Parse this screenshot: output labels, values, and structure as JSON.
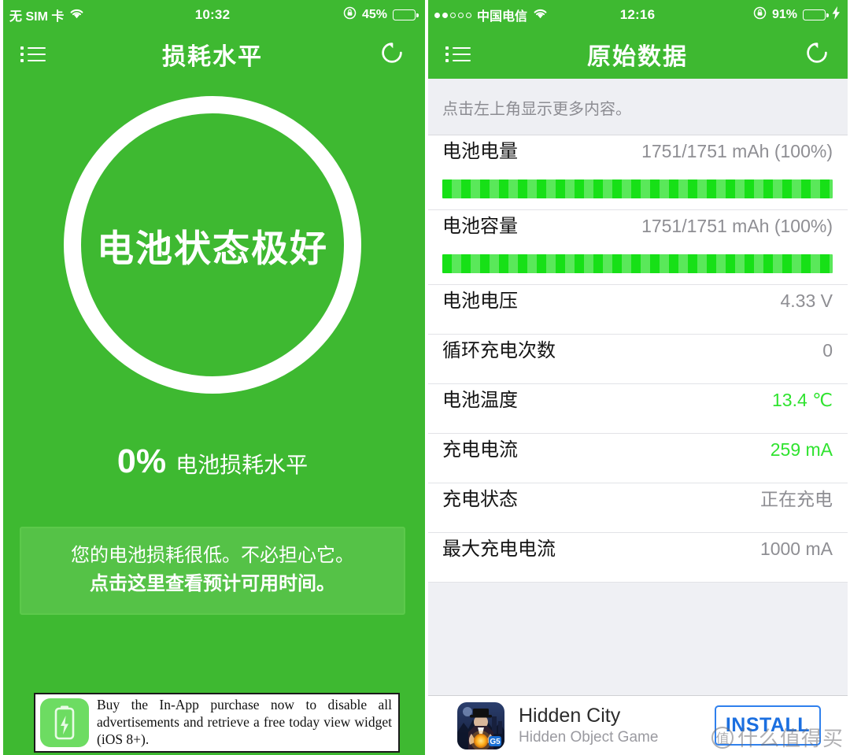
{
  "left": {
    "statusbar": {
      "carrier": "无 SIM 卡",
      "time": "10:32",
      "battery_pct": "45%",
      "battery_level": 45,
      "charging": false,
      "wifi": true,
      "lock_icon": "rotation-lock-icon"
    },
    "navbar": {
      "menu_icon": "list-menu-icon",
      "title": "损耗水平",
      "refresh_icon": "refresh-icon"
    },
    "gauge": {
      "status_text": "电池状态极好",
      "ring_color": "#ffffff",
      "background_color": "#3eb931"
    },
    "loss": {
      "percent": "0%",
      "label": "电池损耗水平"
    },
    "info_box": {
      "line1": "您的电池损耗很低。不必担心它。",
      "line2": "点击这里查看预计可用时间。",
      "background_color": "#55c247"
    },
    "ad": {
      "icon": "battery-bolt-icon",
      "text": "Buy the In-App purchase now to disable all advertisements and retrieve a free today view widget (iOS 8+)."
    }
  },
  "right": {
    "statusbar": {
      "signal_dots_filled": 2,
      "signal_dots_total": 5,
      "carrier": "中国电信",
      "time": "12:16",
      "battery_pct": "91%",
      "battery_level": 91,
      "charging": true,
      "wifi": true,
      "lock_icon": "rotation-lock-icon"
    },
    "navbar": {
      "menu_icon": "list-menu-icon",
      "title": "原始数据",
      "refresh_icon": "refresh-icon"
    },
    "hint": "点击左上角显示更多内容。",
    "rows": [
      {
        "label": "电池电量",
        "value": "1751/1751 mAh (100%)",
        "value_color": "gray",
        "bar": true,
        "bar_percent": 100
      },
      {
        "label": "电池容量",
        "value": "1751/1751 mAh (100%)",
        "value_color": "gray",
        "bar": true,
        "bar_percent": 100
      },
      {
        "label": "电池电压",
        "value": "4.33 V",
        "value_color": "gray",
        "bar": false
      },
      {
        "label": "循环充电次数",
        "value": "0",
        "value_color": "gray",
        "bar": false
      },
      {
        "label": "电池温度",
        "value": "13.4 ℃",
        "value_color": "green",
        "bar": false
      },
      {
        "label": "充电电流",
        "value": "259 mA",
        "value_color": "green",
        "bar": false
      },
      {
        "label": "充电状态",
        "value": "正在充电",
        "value_color": "gray",
        "bar": false
      },
      {
        "label": "最大充电电流",
        "value": "1000 mA",
        "value_color": "gray",
        "bar": false
      }
    ],
    "ad": {
      "title": "Hidden City",
      "subtitle": "Hidden Object Game",
      "install_label": "INSTALL",
      "icon": "hidden-city-app-icon"
    }
  },
  "watermark": {
    "symbol": "值",
    "text": "什么值得买"
  },
  "colors": {
    "brand_green": "#3eb931",
    "bar_green": "#17e017",
    "value_green": "#2fe32f",
    "gray_value": "#8e8e93",
    "install_blue": "#1b6fe0"
  }
}
